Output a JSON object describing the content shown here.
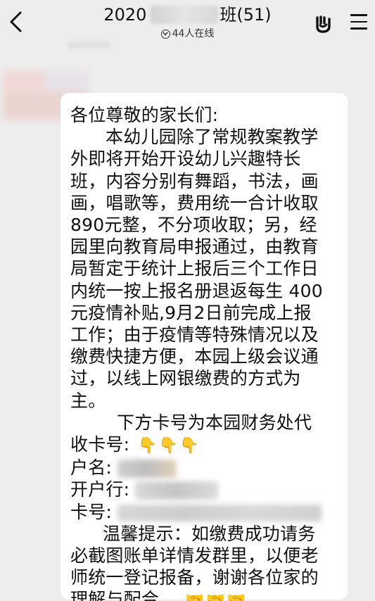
{
  "header": {
    "title_prefix": "2020",
    "title_suffix": "班(51)",
    "online_count_text": "44人在线"
  },
  "icons": {
    "back": "chevron-left-icon",
    "online": "online-status-icon",
    "hand": "hand-gesture-icon",
    "menu": "hamburger-menu-icon",
    "pointing_down": "👇",
    "handshake": "🤝"
  },
  "message": {
    "greeting": "各位尊敬的家长们:",
    "body_lines": [
      "本幼儿园除了常规教案教学",
      "外即将开始开设幼儿兴趣特长",
      "班，内容分别有舞蹈，书法，画",
      "画，唱歌等，费用统一合计收取",
      "890元整，不分项收取；另，经",
      "园里向教育局申报通过，由教育",
      "局暂定于统计上报后三个工作日",
      "内统一按上报名册退返每生 400",
      "元疫情补贴,9月2日前完成上报",
      "工作；由于疫情等特殊情况以及",
      "缴费快捷方便，本园上级会议通",
      "过，以线上网银缴费的方式为",
      "主。"
    ],
    "account_intro_1": "下方卡号为本园财务处代",
    "account_intro_2": "收卡号:",
    "pointing_emojis": "👇👇👇",
    "account_name_label": "户名:",
    "bank_label": "开户行:",
    "card_label": "卡号:",
    "tip_lines": [
      "温馨提示：如缴费成功请务",
      "必截图账单详情发群里，以便老",
      "师统一登记报备，谢谢各位家的",
      "理解与配合。"
    ],
    "handshake_emojis": "🤝🤝🤝"
  },
  "colors": {
    "background": "#ededed",
    "bubble": "#ffffff",
    "text": "#111111"
  }
}
